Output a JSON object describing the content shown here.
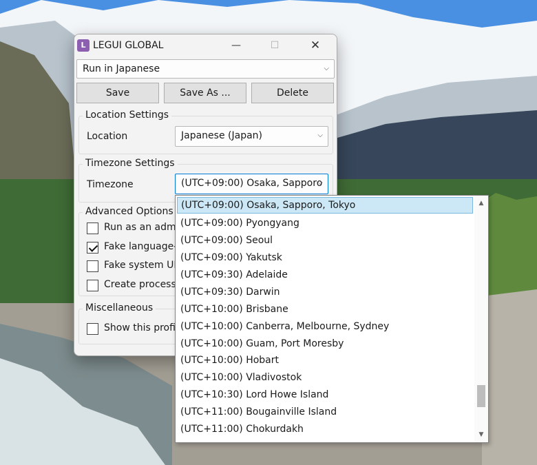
{
  "window": {
    "icon_letter": "L",
    "title": "LEGUI GLOBAL",
    "minimize_glyph": "—",
    "maximize_glyph": "☐",
    "close_glyph": "✕"
  },
  "profile": {
    "selected": "Run in Japanese"
  },
  "buttons": {
    "save": "Save",
    "save_as": "Save As ...",
    "delete": "Delete"
  },
  "location_settings": {
    "title": "Location Settings",
    "label": "Location",
    "value": "Japanese (Japan)"
  },
  "timezone_settings": {
    "title": "Timezone Settings",
    "label": "Timezone",
    "value": "(UTC+09:00) Osaka, Sapporo"
  },
  "advanced_options": {
    "title": "Advanced Options",
    "items": [
      {
        "label": "Run as an admi",
        "checked": false
      },
      {
        "label": "Fake language-",
        "checked": true
      },
      {
        "label": "Fake system UI",
        "checked": false
      },
      {
        "label": "Create process",
        "checked": false
      }
    ]
  },
  "miscellaneous": {
    "title": "Miscellaneous",
    "items": [
      {
        "label": "Show this profil",
        "checked": false
      }
    ]
  },
  "timezone_dropdown": {
    "items": [
      "(UTC+09:00) Osaka, Sapporo, Tokyo",
      "(UTC+09:00) Pyongyang",
      "(UTC+09:00) Seoul",
      "(UTC+09:00) Yakutsk",
      "(UTC+09:30) Adelaide",
      "(UTC+09:30) Darwin",
      "(UTC+10:00) Brisbane",
      "(UTC+10:00) Canberra, Melbourne, Sydney",
      "(UTC+10:00) Guam, Port Moresby",
      "(UTC+10:00) Hobart",
      "(UTC+10:00) Vladivostok",
      "(UTC+10:30) Lord Howe Island",
      "(UTC+11:00) Bougainville Island",
      "(UTC+11:00) Chokurdakh"
    ],
    "selected_index": 0
  },
  "colors": {
    "accent": "#0078d4",
    "selection_bg": "#cce8f6",
    "app_icon": "#8c5fb0"
  }
}
